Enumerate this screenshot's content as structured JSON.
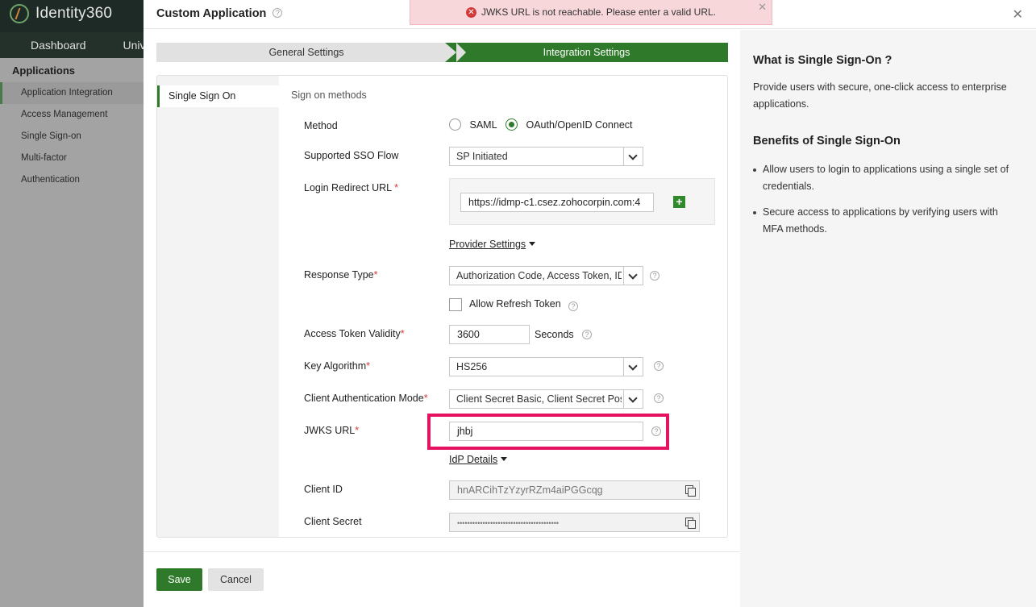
{
  "bg": {
    "app_name": "Identity360",
    "nav": [
      "Dashboard",
      "Univ"
    ],
    "sidebar_head": "Applications",
    "sidebar_items": [
      "Application Integration",
      "Access Management",
      "Single Sign-on",
      "Multi-factor Authentication"
    ]
  },
  "modal": {
    "title": "Custom Application",
    "help_glyph": "?",
    "close_glyph": "✕"
  },
  "toast": {
    "message": "JWKS URL is not reachable. Please enter a valid URL.",
    "icon_glyph": "✕",
    "close_glyph": "✕"
  },
  "steps": [
    "General Settings",
    "Integration Settings"
  ],
  "side_tab": "Single Sign On",
  "form": {
    "section_title": "Sign on methods",
    "method_label": "Method",
    "method_options": [
      "SAML",
      "OAuth/OpenID Connect"
    ],
    "method_selected": "OAuth/OpenID Connect",
    "sso_flow_label": "Supported SSO Flow",
    "sso_flow_value": "SP Initiated",
    "redirect_label": "Login Redirect URL",
    "required_mark": "*",
    "redirect_value": "https://idmp-c1.csez.zohocorpin.com:4",
    "add_glyph": "+",
    "provider_settings": "Provider Settings",
    "response_type_label": "Response Type",
    "response_type_value": "Authorization Code, Access Token, ID",
    "refresh_token_label": "Allow Refresh Token",
    "token_validity_label": "Access Token Validity",
    "token_validity_value": "3600",
    "token_validity_unit": "Seconds",
    "key_algorithm_label": "Key Algorithm",
    "key_algorithm_value": "HS256",
    "client_auth_label": "Client Authentication Mode",
    "client_auth_value": "Client Secret Basic, Client Secret Post",
    "jwks_label": "JWKS URL",
    "jwks_value": "jhbj",
    "idp_details": "IdP Details",
    "client_id_label": "Client ID",
    "client_id_value": "hnARCihTzYzyrRZm4aiPGGcqg",
    "client_secret_label": "Client Secret",
    "client_secret_value": "••••••••••••••••••••••••••••••••••••••••"
  },
  "footer": {
    "save": "Save",
    "cancel": "Cancel"
  },
  "info": {
    "heading1": "What is Single Sign-On ?",
    "para1": "Provide users with secure, one-click access to enterprise applications.",
    "heading2": "Benefits of Single Sign-On",
    "bullets": [
      "Allow users to login to applications using a single set of credentials.",
      "Secure access to applications by verifying users with MFA methods."
    ]
  },
  "colors": {
    "accent_green": "#2e7a2a",
    "error_red": "#d23b3b",
    "highlight_pink": "#e5135f",
    "toast_bg": "#f8d7da"
  }
}
